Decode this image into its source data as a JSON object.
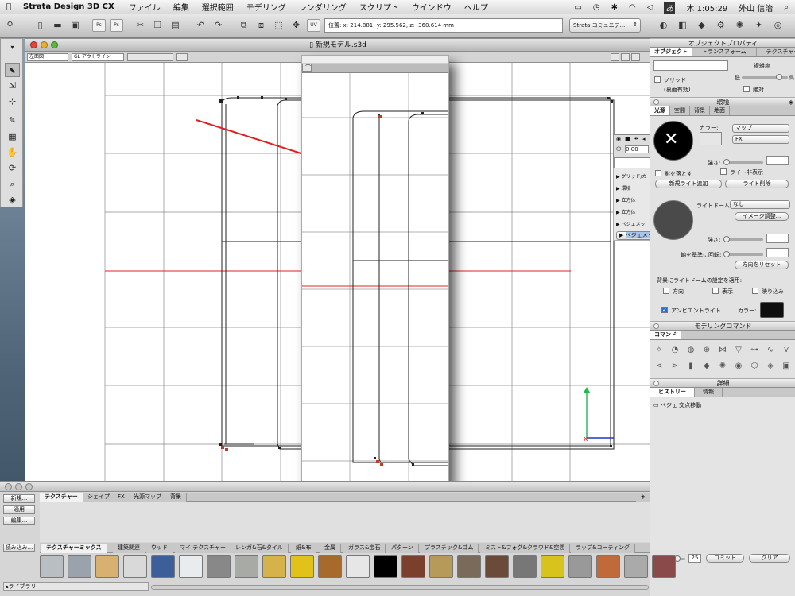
{
  "menubar": {
    "app_name": "Strata Design 3D CX",
    "items": [
      "ファイル",
      "編集",
      "選択範囲",
      "モデリング",
      "レンダリング",
      "スクリプト",
      "ウインドウ",
      "ヘルプ"
    ],
    "ime": "あ",
    "clock": "木 1:05:29",
    "user": "外山 信治"
  },
  "toolbar": {
    "coordinates": "位置: x: 214.881, y: 295.562, z: -360.614 mm",
    "strata_select": "Strata コミュニテ...",
    "ps1": "Ps",
    "ps2": "Ps",
    "uv": "UV"
  },
  "document": {
    "title": "新規モデル.s3d",
    "view_select": "左面図",
    "render_select": "GL アウトライン"
  },
  "timeline": {
    "time": "0:00"
  },
  "scene_items": [
    "グリッド/ガ",
    "環境",
    "立方体",
    "立方体",
    "ベジェメッ",
    "ベジェメッ"
  ],
  "right_panel": {
    "object_props": {
      "title": "オブジェクトプロパティ",
      "tabs": [
        "オブジェクト",
        "トランスフォーム",
        "テクスチャー"
      ],
      "complexity_label": "複雑度",
      "low": "低",
      "high": "高",
      "solid": "ソリッド",
      "solid_sub": "(裏面有効)",
      "absolute": "絶対",
      "complexity_value": 0.85
    },
    "environment": {
      "title": "環境",
      "tabs": [
        "光源",
        "空間",
        "背景",
        "地面"
      ],
      "color_label": "カラー:",
      "map_select": "マップ",
      "fx_select": "FX",
      "strength_label": "強さ:",
      "cast_shadow": "影を落とす",
      "hide_light": "ライト非表示",
      "add_light": "新規ライト追加",
      "delete_light": "ライト削除",
      "lightdome_label": "ライトドーム:",
      "lightdome_value": "なし",
      "image_adjust": "イメージ調整...",
      "strength2_label": "強さ:",
      "rotate_label": "軸を基準に回転:",
      "reset_dir": "方向をリセット",
      "apply_bg": "背景にライトドームの設定を適用:",
      "dir": "方向",
      "show": "表示",
      "reflect": "映り込み",
      "ambient": "アンビエントライト",
      "ambient_color": "カラー:"
    },
    "modeling": {
      "title": "モデリングコマンド",
      "tab": "コマンド"
    },
    "detail": {
      "title": "詳細",
      "tabs": [
        "ヒストリー",
        "情報"
      ],
      "history_item": "ベジェ 交点移動",
      "steps": "25",
      "commit": "コミット",
      "clear": "クリア"
    }
  },
  "texture_panel": {
    "buttons": [
      "新規...",
      "適用",
      "編集..."
    ],
    "load": "読み込み...",
    "library": "ライブラリ",
    "top_tabs": [
      "テクスチャー",
      "シェイプ",
      "FX",
      "光源マップ",
      "背景"
    ],
    "cat_tabs": [
      "テクスチャーミックス",
      "建築関連",
      "ウッド",
      "マイ テクスチャー",
      "レンガ&石&タイル",
      "紙&布",
      "金属",
      "ガラス&宝石",
      "パターン",
      "プラスチック&ゴム",
      "ミスト&フォグ&クラウド&空間",
      "ラップ&コーティング"
    ]
  },
  "colors": {
    "accent": "#2c6cd8",
    "red_line": "#e02020",
    "gizmo_green": "#22b84a"
  }
}
